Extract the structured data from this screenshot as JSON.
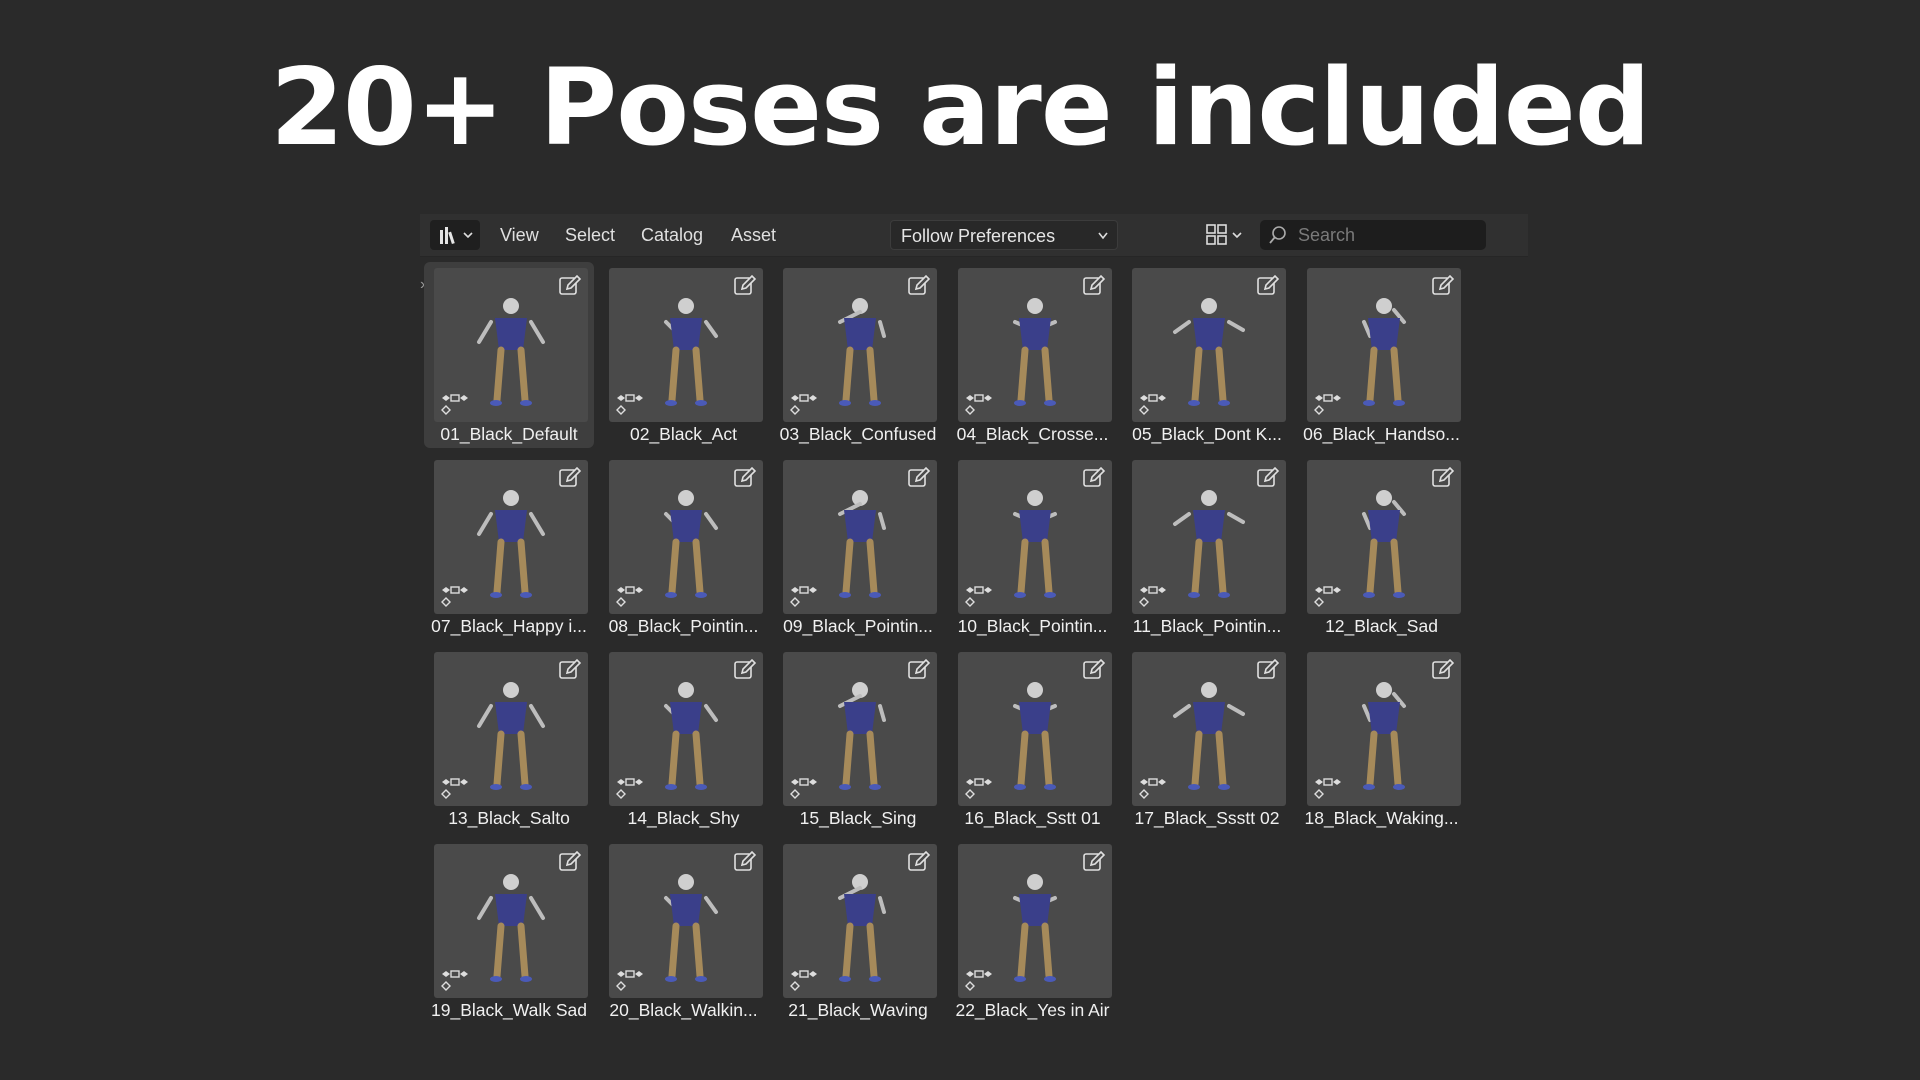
{
  "headline": "20+ Poses are included",
  "toolbar": {
    "menus": [
      "View",
      "Select",
      "Catalog",
      "Asset"
    ],
    "library_dropdown": "Follow Preferences",
    "search_placeholder": "Search"
  },
  "icons": {
    "editor_type": "asset-browser-icon",
    "view_mode": "grid-view-icon",
    "search": "search-icon",
    "edit": "edit-pencil-icon",
    "action": "pose-action-icon"
  },
  "assets": [
    {
      "label": "01_Black_Default",
      "active": true
    },
    {
      "label": "02_Black_Act"
    },
    {
      "label": "03_Black_Confused"
    },
    {
      "label": "04_Black_Crosse..."
    },
    {
      "label": "05_Black_Dont K..."
    },
    {
      "label": "06_Black_Handso..."
    },
    {
      "label": "07_Black_Happy i..."
    },
    {
      "label": "08_Black_Pointin..."
    },
    {
      "label": "09_Black_Pointin..."
    },
    {
      "label": "10_Black_Pointin..."
    },
    {
      "label": "11_Black_Pointin..."
    },
    {
      "label": "12_Black_Sad"
    },
    {
      "label": "13_Black_Salto"
    },
    {
      "label": "14_Black_Shy"
    },
    {
      "label": "15_Black_Sing"
    },
    {
      "label": "16_Black_Sstt 01"
    },
    {
      "label": "17_Black_Ssstt 02"
    },
    {
      "label": "18_Black_Waking..."
    },
    {
      "label": "19_Black_Walk Sad"
    },
    {
      "label": "20_Black_Walkin..."
    },
    {
      "label": "21_Black_Waving"
    },
    {
      "label": "22_Black_Yes in Air"
    }
  ],
  "colors": {
    "background": "#2a2a2a",
    "thumb": "#4a4a4a",
    "shirt": "#3a3f8a",
    "pants": "#a68a5a"
  }
}
